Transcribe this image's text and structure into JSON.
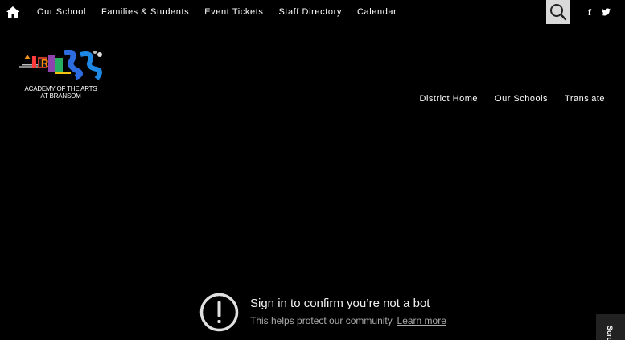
{
  "topnav": {
    "home_icon": "home-icon",
    "items": [
      "Our School",
      "Families & Students",
      "Event Tickets",
      "Staff Directory",
      "Calendar"
    ],
    "search_icon": "search-icon",
    "social": [
      {
        "icon": "facebook-icon",
        "glyph": "f"
      },
      {
        "icon": "twitter-icon",
        "glyph": "t"
      }
    ]
  },
  "logo": {
    "caption_line1": "ACADEMY OF THE ARTS",
    "caption_line2": "AT BRANSOM"
  },
  "subnav": {
    "items": [
      "District Home",
      "Our Schools",
      "Translate"
    ]
  },
  "video_notice": {
    "icon": "alert-icon",
    "title": "Sign in to confirm you’re not a bot",
    "subtitle": "This helps protect our community.",
    "link": "Learn more"
  },
  "scroll_tab": {
    "label": "Scro"
  },
  "colors": {
    "background": "#000000",
    "search_button": "#d9d9d9",
    "text": "#ffffff",
    "muted_text": "#aaaaaa"
  }
}
